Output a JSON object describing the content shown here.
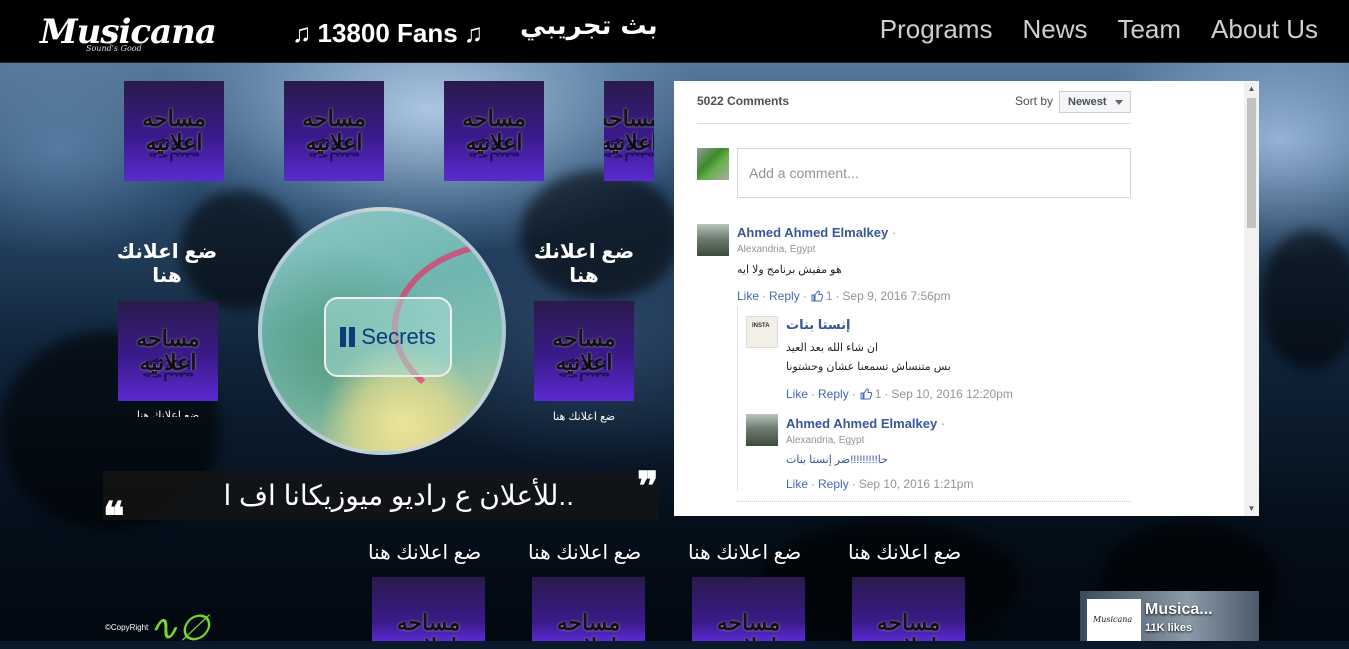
{
  "header": {
    "logo_text": "Musicana",
    "logo_tagline": "Sound's Good",
    "fans_count": "13800 Fans",
    "live_label": "بث تجريبي",
    "nav": [
      "Programs",
      "News",
      "Team",
      "About Us"
    ]
  },
  "ads": {
    "ad_image_text": "مساحه اعلانيه",
    "ad_image_text_reflection": "مساحه اعلانيه",
    "place_label": "ضع اعلانك هنا",
    "place_label_small": "ضع اعلانك هنا"
  },
  "player": {
    "button_label": "Secrets",
    "state": "playing"
  },
  "quote": {
    "text": "..للأعلان ع راديو ميوزيكانا اف ا"
  },
  "bottom_ads": {
    "labels": [
      "ضع اعلانك هنا",
      "ضع اعلانك هنا",
      "ضع اعلانك هنا",
      "ضع اعلانك هنا"
    ]
  },
  "footer": {
    "copyright": "©CopyRight"
  },
  "comments": {
    "count_label": "5022 Comments",
    "sort_label": "Sort by",
    "sort_value": "Newest",
    "input_placeholder": "Add a comment...",
    "items": [
      {
        "name": "Ahmed Ahmed Elmalkey",
        "location": "Alexandria, Egypt",
        "body_lines": [
          "هو مفيش برنامج ولا ايه"
        ],
        "like": "Like",
        "reply": "Reply",
        "likes": "1",
        "date": "Sep 9, 2016 7:56pm"
      },
      {
        "name": "إنستا بنات",
        "location": "",
        "body_lines": [
          "ان شاء الله بعد العيد",
          "بس متنساش تسمعنا عشان وحشتونا"
        ],
        "like": "Like",
        "reply": "Reply",
        "likes": "1",
        "date": "Sep 10, 2016 12:20pm"
      },
      {
        "name": "Ahmed Ahmed Elmalkey",
        "location": "Alexandria, Egypt",
        "body_lines": [
          "حا!!!!!!!!!ضر إنستا بنات"
        ],
        "like": "Like",
        "reply": "Reply",
        "likes": "",
        "date": "Sep 10, 2016 1:21pm"
      }
    ],
    "avatar_insta_text": "INSTA"
  },
  "fb_widget": {
    "page_name": "Musica...",
    "likes": "11K likes",
    "thumb_text": "Musicana"
  },
  "colors": {
    "nav_bg": "#000000",
    "link_blue": "#365899",
    "action_blue": "#4267b2",
    "ad_purple": "#3a1a8a",
    "player_text": "#0d3c7a"
  }
}
